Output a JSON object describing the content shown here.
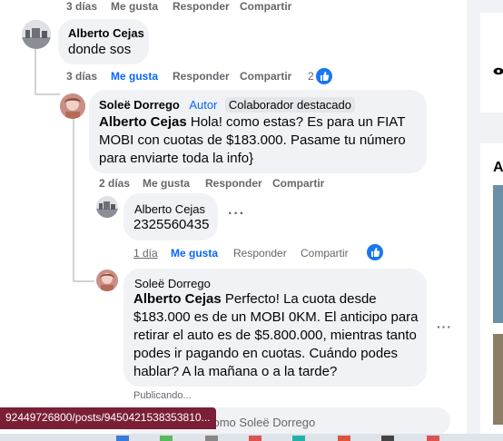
{
  "comments": [
    {
      "actions": {
        "time": "3 días",
        "like": "Me gusta",
        "reply": "Responder",
        "share": "Compartir"
      }
    },
    {
      "author": "Alberto Cejas",
      "text": "donde sos",
      "actions": {
        "time": "3 días",
        "like": "Me gusta",
        "reply": "Responder",
        "share": "Compartir",
        "reaction_count": "2"
      }
    },
    {
      "author": "Soleë Dorrego",
      "author_badge": "Autor",
      "badge": "Colaborador destacado",
      "mention": "Alberto Cejas",
      "text": " Hola! como estas? Es para un FIAT MOBI con cuotas de $183.000. Pasame tu número para enviarte toda la info}",
      "actions": {
        "time": "2 días",
        "like": "Me gusta",
        "reply": "Responder",
        "share": "Compartir"
      }
    },
    {
      "author": "Alberto Cejas",
      "text": "2325560435",
      "actions": {
        "time": "1 día",
        "like": "Me gusta",
        "reply": "Responder",
        "share": "Compartir"
      }
    },
    {
      "author": "Soleë Dorrego",
      "mention": "Alberto Cejas",
      "text": " Perfecto! La cuota desde $183.000 es de un MOBI 0KM. El anticipo para retirar el auto es de $5.800.000, mientras tanto podes ir pagando en cuotas. Cuándo podes hablar? A la mañana o a la tarde?",
      "status": "Publicando..."
    }
  ],
  "reply_box": {
    "placeholder": "como Soleë Dorrego"
  },
  "status_bar": {
    "url": "92449726800/posts/9450421538353810..."
  },
  "right_rail": {
    "letter": "A"
  },
  "icons": {
    "like": "thumbs-up-icon",
    "more": "more-dots-icon",
    "eye": "eye-icon"
  },
  "colors": {
    "accent": "#0866ff",
    "bubble": "#f0f2f5",
    "status_bar": "#7a1f36"
  }
}
